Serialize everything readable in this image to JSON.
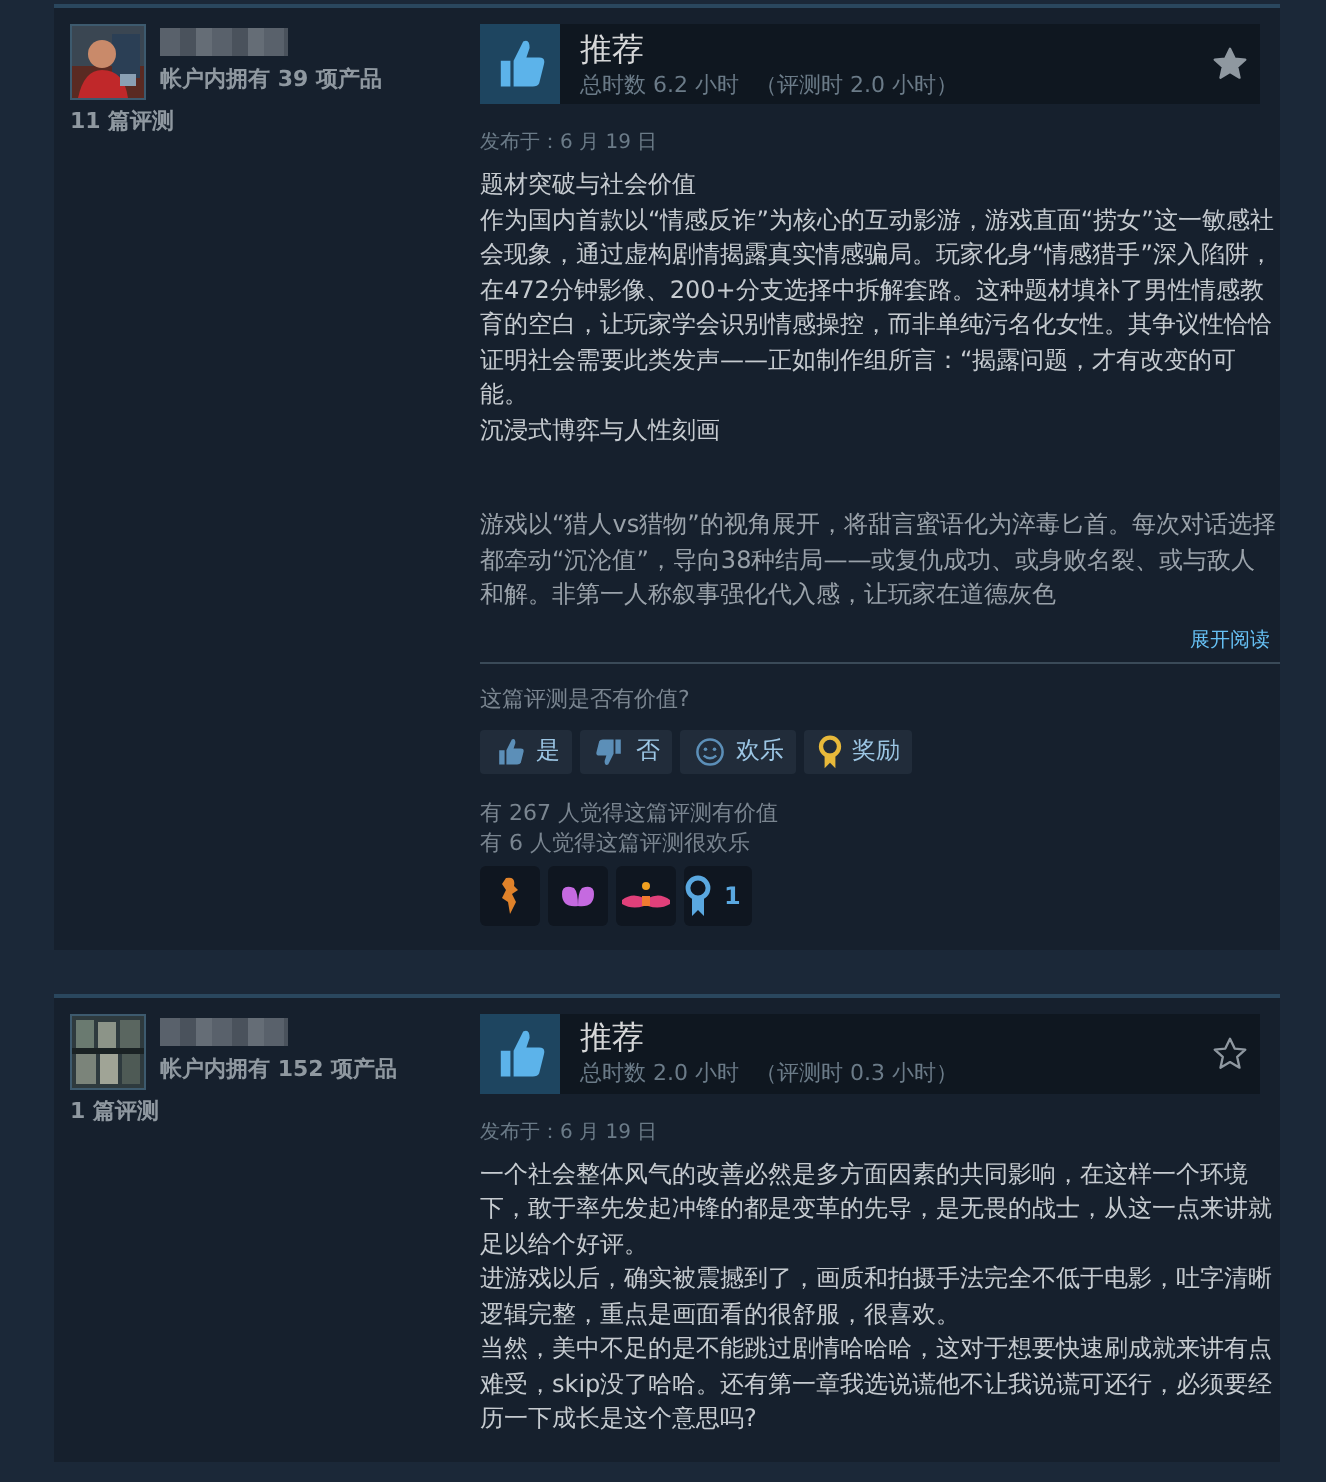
{
  "reviews": [
    {
      "owned": "帐户内拥有 39 项产品",
      "review_count": "11 篇评测",
      "verdict": "推荐",
      "hours": "总时数 6.2 小时",
      "hours_at_review": "（评测时 2.0 小时）",
      "starred": true,
      "posted": "发布于：6 月 19 日",
      "paragraphs": [
        "题材突破与社会价值",
        "作为国内首款以“情感反诈”为核心的互动影游，游戏直面“捞女”这一敏感社会现象，通过虚构剧情揭露真实情感骗局。玩家化身“情感猎手”深入陷阱，在472分钟影像、200+分支选择中拆解套路。这种题材填补了男性情感教育的空白，让玩家学会识别情感操控，而非单纯污名化女性。其争议性恰恰证明社会需要此类发声——正如制作组所言：“揭露问题，才有改变的可能。",
        "沉浸式博弈与人性刻画",
        {
          "gap_before": true,
          "text": "游戏以“猎人vs猎物”的视角展开，将甜言蜜语化为淬毒匕首。每次对话选择都牵动“沉沦值”，导向38种结局——或复仇成功、或身败名裂、或与敌人和解。非第一人称叙事强化代入感，让玩家在道德灰色"
        }
      ],
      "collapsed": true,
      "expand": "展开阅读",
      "helpful_prompt": "这篇评测是否有价值?",
      "votes": [
        {
          "kind": "up",
          "label": "是"
        },
        {
          "kind": "down",
          "label": "否"
        },
        {
          "kind": "funny",
          "label": "欢乐"
        },
        {
          "kind": "award",
          "label": "奖励"
        }
      ],
      "stats": [
        "有 267 人觉得这篇评测有价值",
        "有 6 人觉得这篇评测很欢乐"
      ],
      "awards": [
        {
          "kind": "figure"
        },
        {
          "kind": "wings"
        },
        {
          "kind": "hands"
        },
        {
          "kind": "ribbon",
          "count": "1"
        }
      ]
    },
    {
      "owned": "帐户内拥有 152 项产品",
      "review_count": "1 篇评测",
      "verdict": "推荐",
      "hours": "总时数 2.0 小时",
      "hours_at_review": "（评测时 0.3 小时）",
      "starred": false,
      "posted": "发布于：6 月 19 日",
      "paragraphs": [
        "一个社会整体风气的改善必然是多方面因素的共同影响，在这样一个环境下，敢于率先发起冲锋的都是变革的先导，是无畏的战士，从这一点来讲就足以给个好评。",
        "进游戏以后，确实被震撼到了，画质和拍摄手法完全不低于电影，吐字清晰逻辑完整，重点是画面看的很舒服，很喜欢。",
        "当然，美中不足的是不能跳过剧情哈哈哈，这对于想要快速刷成就来讲有点难受，skip没了哈哈。还有第一章我选说谎他不让我说谎可还行，必须要经历一下成长是这个意思吗?"
      ],
      "collapsed": false
    }
  ]
}
